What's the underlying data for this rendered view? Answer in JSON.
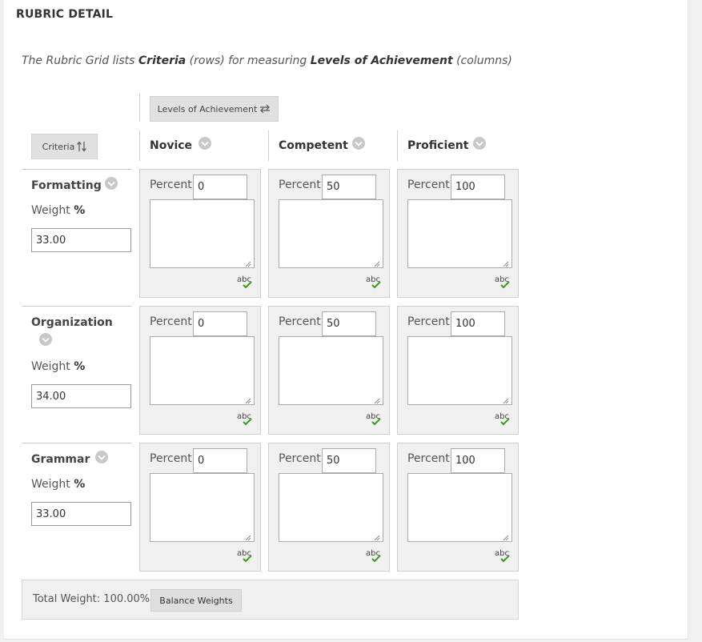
{
  "page": {
    "title": "RUBRIC DETAIL",
    "intro": {
      "part1": "The Rubric Grid lists ",
      "criteria_word": "Criteria",
      "part2": " (rows) for measuring ",
      "levels_word": "Levels of Achievement",
      "part3": " (columns)"
    }
  },
  "toolbar": {
    "levels_button": "Levels of Achievement",
    "criteria_button": "Criteria",
    "levels_icon": "swap-horizontal-icon",
    "criteria_icon": "swap-vertical-icon"
  },
  "levels": [
    {
      "name": "Novice"
    },
    {
      "name": "Competent"
    },
    {
      "name": "Proficient"
    }
  ],
  "percent_label": "Percent",
  "weight": {
    "label": "Weight",
    "unit": "%"
  },
  "criteria": [
    {
      "name": "Formatting",
      "weight": "33.00",
      "percents": [
        "0",
        "50",
        "100"
      ]
    },
    {
      "name": "Organization",
      "weight": "34.00",
      "percents": [
        "0",
        "50",
        "100"
      ]
    },
    {
      "name": "Grammar",
      "weight": "33.00",
      "percents": [
        "0",
        "50",
        "100"
      ]
    }
  ],
  "footer": {
    "total_weight": "Total Weight: 100.00%",
    "balance_button": "Balance Weights"
  },
  "colors": {
    "chevron": "#c8c8c8",
    "spellcheck_check": "#3a9a1a",
    "cell_bg": "#f0f0f0"
  },
  "icons": {
    "column_menu": "chevron-down-icon",
    "spellcheck": "spellcheck-icon",
    "resize": "resize-grip-icon"
  }
}
